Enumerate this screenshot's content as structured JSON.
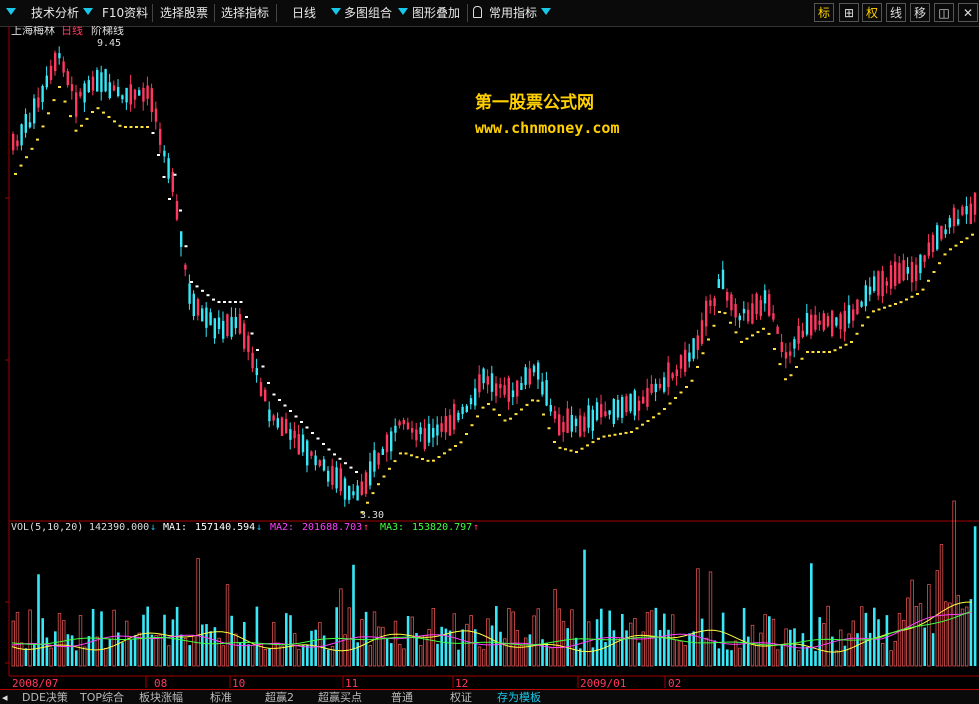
{
  "toolbar": {
    "items": [
      "技术分析",
      "F10资料",
      "选择股票",
      "选择指标",
      "日线",
      "多图组合",
      "图形叠加",
      "常用指标"
    ],
    "right_buttons": [
      "标",
      "⊞",
      "权",
      "线",
      "移",
      "◫",
      "✕"
    ]
  },
  "chart": {
    "stock_name": "上海梅林",
    "period": "日线",
    "indicator": "阶梯线",
    "high_label": "9.45",
    "low_label": "3.30",
    "watermark_title": "第一股票公式网",
    "watermark_url": "www.chnmoney.com",
    "dates": [
      "2008/07",
      "08",
      "10",
      "11",
      "12",
      "2009/01",
      "02"
    ]
  },
  "volume": {
    "label": "VOL(5,10,20)",
    "value": "142390.000",
    "value_arrow": "↓",
    "ma1_label": "MA1:",
    "ma1_value": "157140.594",
    "ma1_arrow": "↓",
    "ma2_label": "MA2:",
    "ma2_value": "201688.703",
    "ma2_arrow": "↑",
    "ma3_label": "MA3:",
    "ma3_value": "153820.797",
    "ma3_arrow": "↑"
  },
  "tabs": [
    "DDE决策",
    "TOP综合",
    "板块涨幅",
    "标准",
    "超赢2",
    "超赢买点",
    "普通",
    "权证",
    "存为模板"
  ],
  "colors": {
    "up": "#ff3860",
    "down": "#38e8f8",
    "accent": "#ffd000",
    "ma1": "#ffffff",
    "ma2": "#ff40ff",
    "ma3": "#40ff40",
    "grid": "#a00000"
  },
  "chart_data": {
    "type": "candlestick",
    "y_low": 3.3,
    "y_high": 9.45,
    "x": [
      "2008/07",
      "08",
      "10",
      "11",
      "12",
      "2009/01",
      "02"
    ]
  }
}
